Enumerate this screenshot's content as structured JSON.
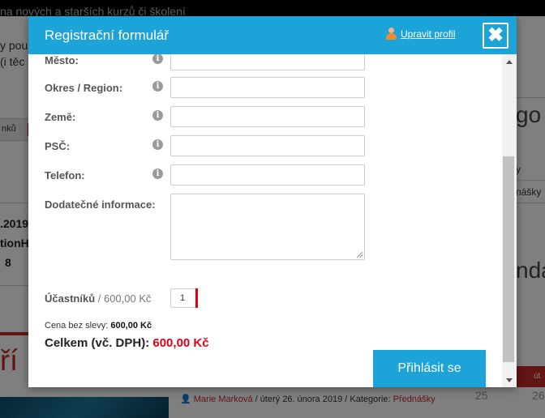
{
  "background": {
    "topbar_text": "na nových a starších kurzů či školení",
    "intro_line1": "y pou",
    "intro_line2": "(i těc",
    "strip_text": "nků",
    "dark1": ".2019",
    "dark2": "tionH",
    "dark3": "8",
    "red_big": "ří",
    "right_title1": "go",
    "right_title2": "ndá",
    "right_text1": "y",
    "right_text2": "nášky",
    "meta_author": "Marie Marková",
    "meta_date": "úterý 26. února 2019",
    "meta_category_label": "Kategorie:",
    "meta_category": "Přednášky",
    "cal_header": "út",
    "cal_num1": "25",
    "cal_num2": "26"
  },
  "modal": {
    "title": "Registrační formulář",
    "profile_link": "Upravit profil",
    "close_label": "✖",
    "fields": {
      "city": "Město:",
      "region": "Okres / Region:",
      "country": "Země:",
      "zip": "PSČ:",
      "phone": "Telefon:",
      "notes": "Dodatečné informace:"
    },
    "info_glyph": "i",
    "participants_label": "Účastníků",
    "participants_price": " / 600,00 Kč",
    "participants_value": "1",
    "price_label": "Cena bez slevy: ",
    "price_value": "600,00 Kč",
    "total_label": "Celkem (vč. DPH): ",
    "total_value": "600,00 Kč",
    "submit_label": "Přihlásit se"
  },
  "colors": {
    "primary": "#1ca4d9",
    "accent_red": "#e30016"
  }
}
